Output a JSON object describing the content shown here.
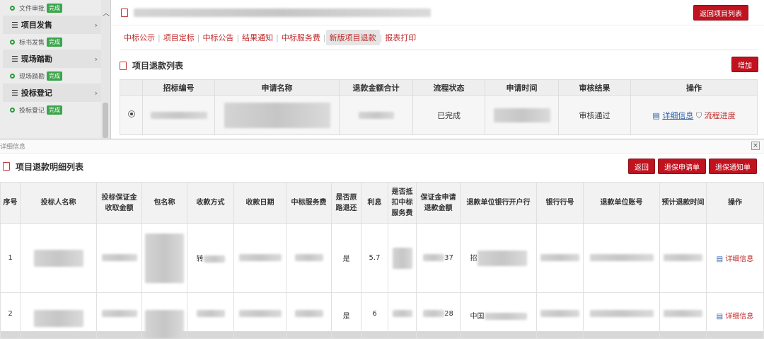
{
  "sidebar": {
    "items": [
      {
        "type": "sub",
        "label": "文件审批",
        "status": "完成"
      },
      {
        "type": "group",
        "label": "项目发售"
      },
      {
        "type": "sub",
        "label": "标书发售",
        "status": "完成"
      },
      {
        "type": "group",
        "label": "现场踏勘"
      },
      {
        "type": "sub",
        "label": "现场踏勘",
        "status": "完成"
      },
      {
        "type": "group",
        "label": "投标登记"
      },
      {
        "type": "sub",
        "label": "投标登记",
        "status": "完成"
      }
    ]
  },
  "main": {
    "back_button": "返回项目列表",
    "tabs": [
      "中标公示",
      "项目定标",
      "中标公告",
      "结果通知",
      "中标服务费",
      "新版项目退款",
      "报表打印"
    ],
    "active_tab": 5,
    "section_title": "项目退款列表",
    "add_button": "增加",
    "columns": [
      "",
      "招标编号",
      "申请名称",
      "退款金额合计",
      "流程状态",
      "申请时间",
      "审核结果",
      "操作"
    ],
    "row": {
      "status": "已完成",
      "audit": "审核通过",
      "action_detail": "详细信息",
      "action_progress": "流程进度"
    }
  },
  "dialog": {
    "title": "详细信息",
    "heading": "项目退款明细列表",
    "buttons": [
      "返回",
      "退保申请单",
      "退保通知单"
    ],
    "columns": [
      "序号",
      "投标人名称",
      "投标保证金收取金额",
      "包名称",
      "收款方式",
      "收款日期",
      "中标服务费",
      "是否原路退还",
      "利息",
      "是否抵扣中标服务费",
      "保证金申请退款金额",
      "退款单位银行开户行",
      "银行行号",
      "退款单位账号",
      "预计退款时间",
      "操作"
    ],
    "rows": [
      {
        "index": "1",
        "refund_original": "是",
        "interest": "5.7",
        "amount_tail": "37",
        "method_prefix": "转",
        "bank_prefix": "招",
        "action": "详细信息"
      },
      {
        "index": "2",
        "refund_original": "是",
        "interest": "6",
        "amount_tail": "28",
        "bank_prefix": "中国",
        "action": "详细信息"
      }
    ]
  }
}
